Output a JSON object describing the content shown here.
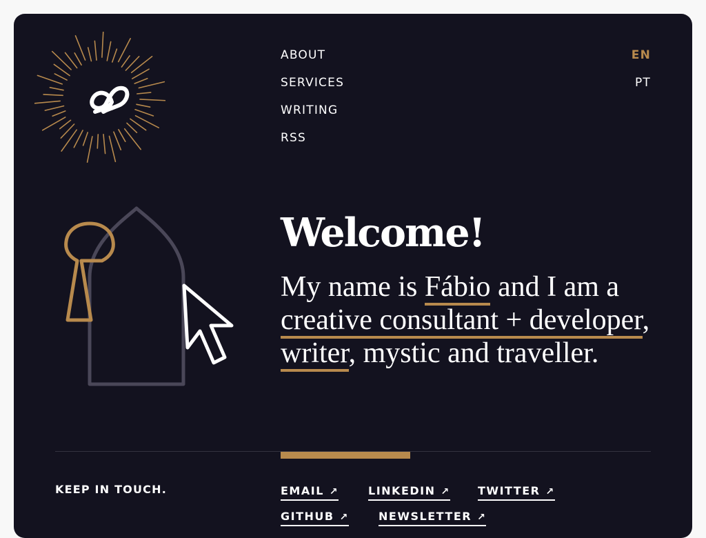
{
  "nav": {
    "items": [
      {
        "label": "ABOUT"
      },
      {
        "label": "SERVICES"
      },
      {
        "label": "WRITING"
      },
      {
        "label": "RSS"
      }
    ]
  },
  "lang": {
    "items": [
      {
        "label": "EN",
        "active": true
      },
      {
        "label": "PT",
        "active": false
      }
    ]
  },
  "hero": {
    "title": "Welcome!",
    "intro_prefix": "My name is ",
    "name_link": "Fábio",
    "intro_mid1": " and I am a ",
    "consultant_link": "creative consultant + developer",
    "intro_sep": ", ",
    "writer_link": "writer",
    "intro_suffix": ", mystic and traveller."
  },
  "footer": {
    "keep_in_touch": "KEEP IN TOUCH.",
    "links": [
      {
        "label": "EMAIL",
        "icon": "arrow-up-right-icon"
      },
      {
        "label": "LINKEDIN",
        "icon": "arrow-up-right-icon"
      },
      {
        "label": "TWITTER",
        "icon": "arrow-up-right-icon"
      },
      {
        "label": "GITHUB",
        "icon": "arrow-up-right-icon"
      },
      {
        "label": "NEWSLETTER",
        "icon": "arrow-up-right-icon"
      }
    ],
    "arrow_glyph": "↗"
  },
  "colors": {
    "background": "#13121f",
    "accent": "#b88a4d",
    "text": "#ffffff",
    "muted": "#4a4758"
  }
}
